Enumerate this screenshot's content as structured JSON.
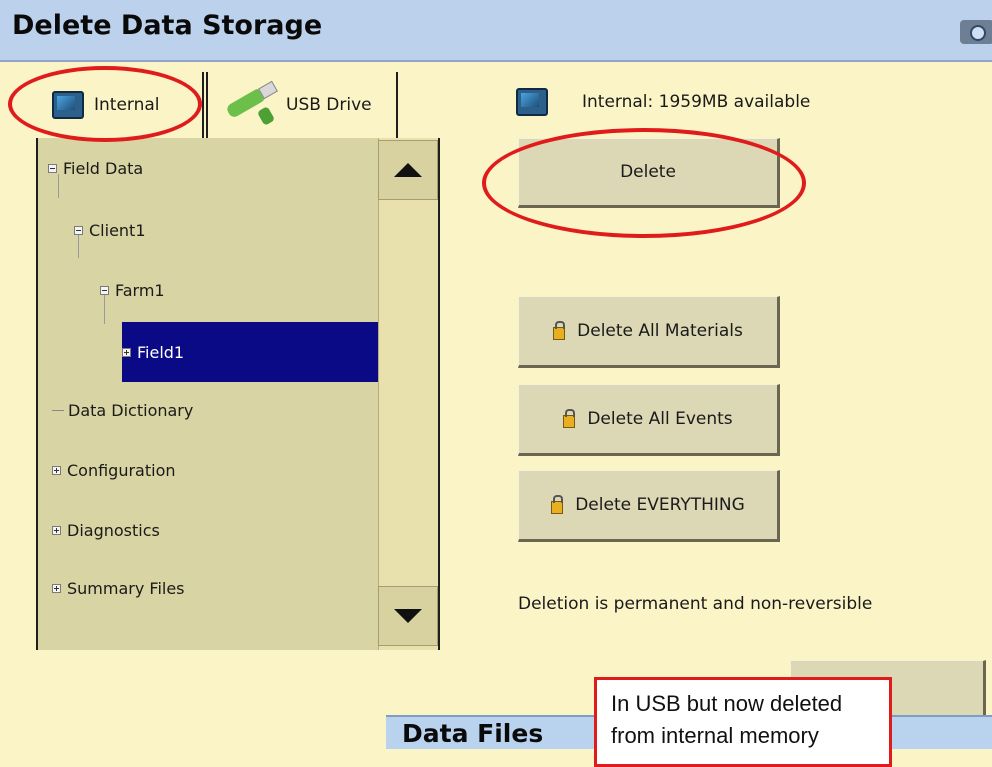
{
  "window": {
    "title": "Delete Data Storage"
  },
  "tabs": [
    {
      "label": "Internal",
      "icon": "internal-storage-icon"
    },
    {
      "label": "USB Drive",
      "icon": "usb-drive-icon"
    }
  ],
  "tree": {
    "items": [
      {
        "label": "Field Data",
        "expander": "minus"
      },
      {
        "label": "Client1",
        "expander": "minus"
      },
      {
        "label": "Farm1",
        "expander": "minus"
      },
      {
        "label": "Field1",
        "expander": "plus",
        "selected": true
      },
      {
        "label": "Data Dictionary",
        "expander": "none"
      },
      {
        "label": "Configuration",
        "expander": "plus"
      },
      {
        "label": "Diagnostics",
        "expander": "plus"
      },
      {
        "label": "Summary Files",
        "expander": "plus"
      }
    ]
  },
  "storage": {
    "status": "Internal: 1959MB available"
  },
  "actions": {
    "delete": "Delete",
    "delete_all_materials": "Delete All Materials",
    "delete_all_events": "Delete All Events",
    "delete_everything": "Delete EVERYTHING"
  },
  "warning": "Deletion is permanent and non-reversible",
  "overlay": {
    "title": "Data Files",
    "callout_line1": "In USB but now deleted",
    "callout_line2": "from internal memory"
  },
  "colors": {
    "background": "#fbf4c6",
    "titlebar": "#bcd1ec",
    "selection": "#0a0a86",
    "annotation": "#e01b1b"
  }
}
